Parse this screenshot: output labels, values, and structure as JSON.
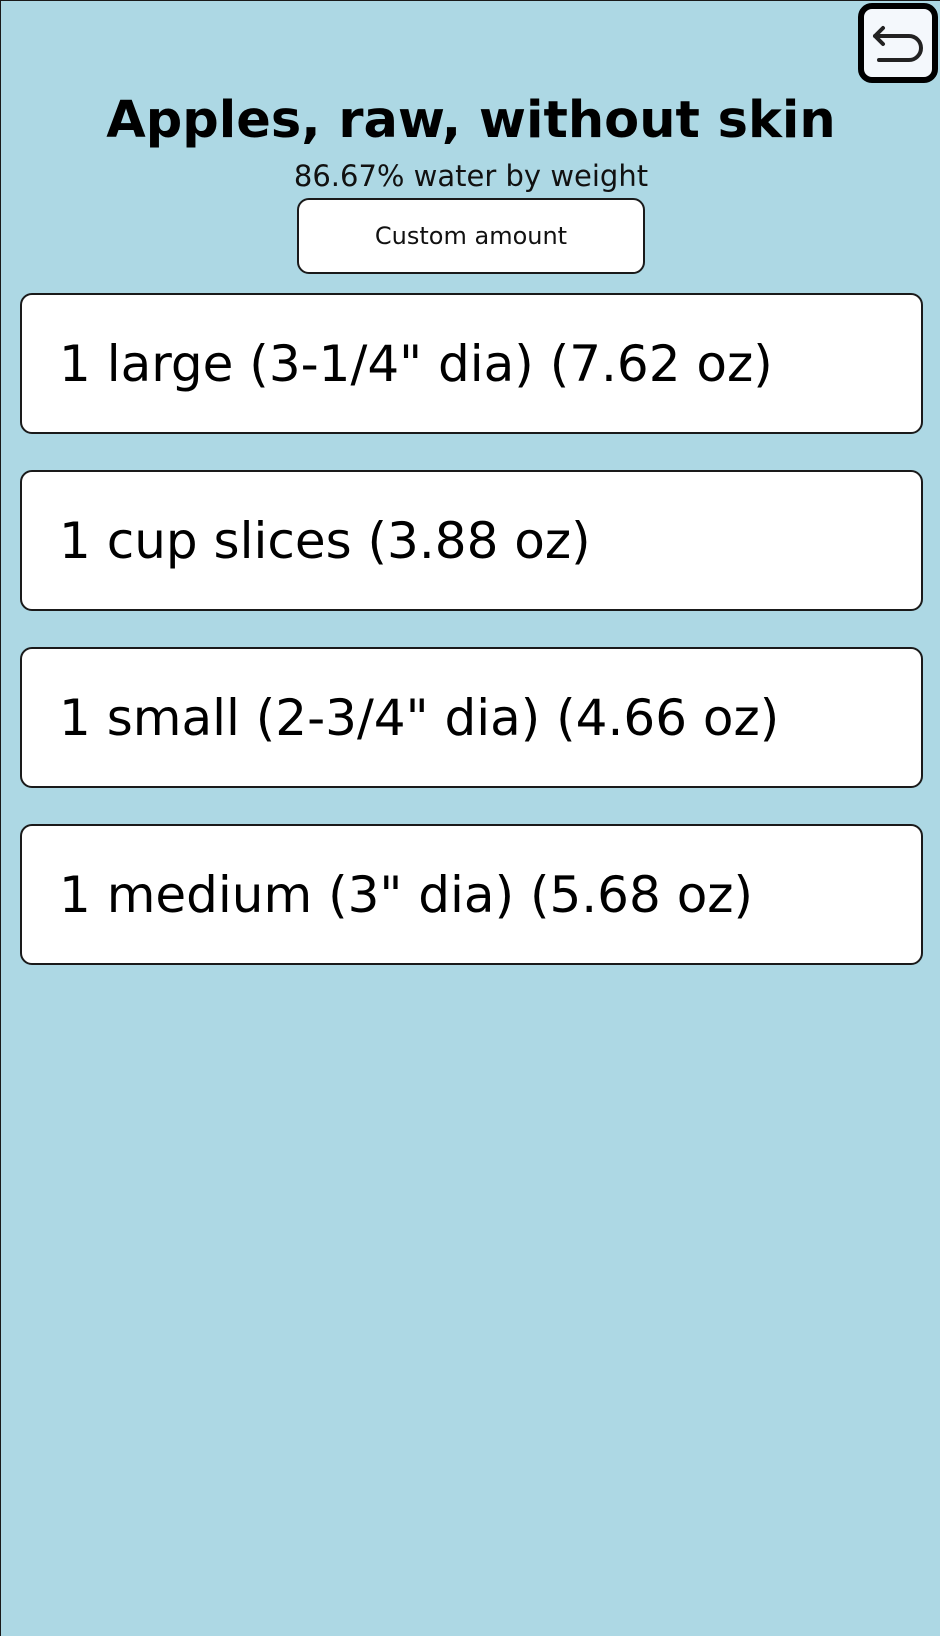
{
  "header": {
    "back_icon": "undo-arrow-icon",
    "title": "Apples, raw, without skin",
    "subtitle": "86.67% water by weight",
    "custom_amount_label": "Custom amount"
  },
  "servings": [
    {
      "label": "1 large (3-1/4\" dia) (7.62 oz)"
    },
    {
      "label": "1 cup slices (3.88 oz)"
    },
    {
      "label": "1 small (2-3/4\" dia) (4.66 oz)"
    },
    {
      "label": "1 medium (3\" dia) (5.68 oz)"
    }
  ],
  "colors": {
    "background": "#add8e4",
    "card": "#ffffff",
    "border": "#1a1a1a"
  }
}
